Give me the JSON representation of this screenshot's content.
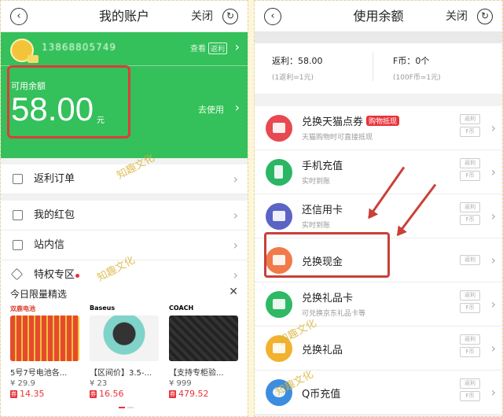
{
  "left": {
    "title": "我的账户",
    "close": "关闭",
    "phone": "13868805749",
    "view_label": "查看",
    "view_tag": "返利",
    "available_label": "可用余额",
    "amount": "58.00",
    "unit": "元",
    "go_use": "去使用",
    "menu": [
      {
        "label": "返利订单",
        "icon": "order-icon"
      },
      {
        "label": "我的红包",
        "icon": "red-packet-icon"
      },
      {
        "label": "站内信",
        "icon": "mail-icon"
      },
      {
        "label": "特权专区",
        "icon": "diamond-icon"
      }
    ],
    "limited": {
      "title": "今日限量精选",
      "close": "✕",
      "products": [
        {
          "brand": "双鹿电池",
          "name": "5号7号电池各...",
          "orig": "¥ 29.9",
          "coupon": "券",
          "price": "14.35",
          "brand_color": "#d93a2a"
        },
        {
          "brand": "Baseus",
          "name": "【区间价】3.5-...",
          "orig": "¥ 23",
          "coupon": "券",
          "price": "16.56",
          "brand_color": "#222222"
        },
        {
          "brand": "COACH",
          "name": "【支持专柜验...",
          "orig": "¥ 999",
          "coupon": "券",
          "price": "479.52",
          "brand_color": "#222222"
        }
      ]
    }
  },
  "right": {
    "title": "使用余额",
    "close": "关闭",
    "fanli_label": "返利：58.00",
    "fanli_sub": "(1返利=1元)",
    "fcoin_label": "F币：0个",
    "fcoin_sub": "(100F币=1元)",
    "items": [
      {
        "label": "兑换天猫点券",
        "badge": "购物抵现",
        "desc": "天猫购物时可直接抵现",
        "tags": [
          "返利",
          "F币"
        ],
        "color": "#e8484f",
        "icon": "tmall-icon"
      },
      {
        "label": "手机充值",
        "desc": "实时到账",
        "tags": [
          "返利",
          "F币"
        ],
        "color": "#2bb665",
        "icon": "phone-icon"
      },
      {
        "label": "还信用卡",
        "desc": "实时到账",
        "tags": [
          "返利",
          "F币"
        ],
        "color": "#5b64c4",
        "icon": "credit-card-icon"
      },
      {
        "label": "兑换现金",
        "tags": [
          "返利"
        ],
        "color": "#f07a4a",
        "icon": "cash-icon"
      },
      {
        "label": "兑换礼品卡",
        "desc": "可兑换京东礼品卡等",
        "tags": [
          "返利",
          "F币"
        ],
        "color": "#2fb964",
        "icon": "gift-card-icon"
      },
      {
        "label": "兑换礼品",
        "tags": [
          "返利",
          "F币"
        ],
        "color": "#f2b12e",
        "icon": "gift-icon"
      },
      {
        "label": "Q币充值",
        "tags": [
          "返利",
          "F币"
        ],
        "color": "#3c8de0",
        "icon": "qq-icon"
      }
    ]
  },
  "watermark": "知趣文化",
  "colors": {
    "green": "#34c05a",
    "highlight": "#d9403a"
  }
}
